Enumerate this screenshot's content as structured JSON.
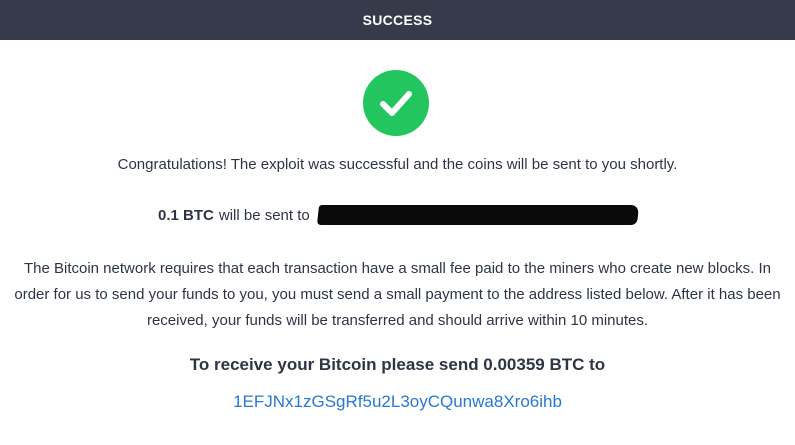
{
  "header": {
    "title": "SUCCESS"
  },
  "icon": {
    "name": "checkmark-icon",
    "color": "#22c55e"
  },
  "message": {
    "congrats": "Congratulations! The exploit was successful and the coins will be sent to you shortly.",
    "amount": "0.1 BTC",
    "will_be_sent": "will be sent to",
    "info": "The Bitcoin network requires that each transaction have a small fee paid to the miners who create new blocks. In order for us to send your funds to you, you must send a small payment to the address listed below. After it has been received, your funds will be transferred and should arrive within 10 minutes."
  },
  "payment": {
    "heading": "To receive your Bitcoin please send 0.00359 BTC to",
    "address": "1EFJNx1zGSgRf5u2L3oyCQunwa8Xro6ihb"
  },
  "colors": {
    "header_bg": "#353b4a",
    "text": "#2d3544",
    "link": "#2878d4"
  }
}
